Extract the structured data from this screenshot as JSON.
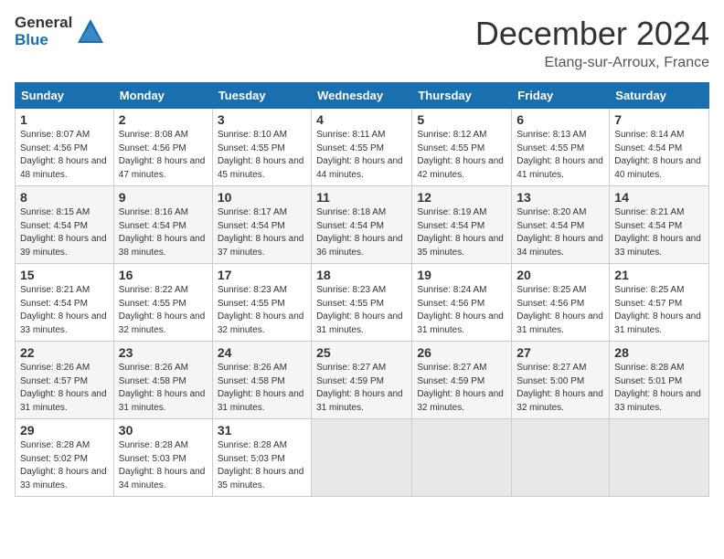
{
  "header": {
    "logo_general": "General",
    "logo_blue": "Blue",
    "month": "December 2024",
    "location": "Etang-sur-Arroux, France"
  },
  "weekdays": [
    "Sunday",
    "Monday",
    "Tuesday",
    "Wednesday",
    "Thursday",
    "Friday",
    "Saturday"
  ],
  "weeks": [
    [
      {
        "day": 1,
        "sunrise": "8:07 AM",
        "sunset": "4:56 PM",
        "daylight": "8 hours and 48 minutes."
      },
      {
        "day": 2,
        "sunrise": "8:08 AM",
        "sunset": "4:56 PM",
        "daylight": "8 hours and 47 minutes."
      },
      {
        "day": 3,
        "sunrise": "8:10 AM",
        "sunset": "4:55 PM",
        "daylight": "8 hours and 45 minutes."
      },
      {
        "day": 4,
        "sunrise": "8:11 AM",
        "sunset": "4:55 PM",
        "daylight": "8 hours and 44 minutes."
      },
      {
        "day": 5,
        "sunrise": "8:12 AM",
        "sunset": "4:55 PM",
        "daylight": "8 hours and 42 minutes."
      },
      {
        "day": 6,
        "sunrise": "8:13 AM",
        "sunset": "4:55 PM",
        "daylight": "8 hours and 41 minutes."
      },
      {
        "day": 7,
        "sunrise": "8:14 AM",
        "sunset": "4:54 PM",
        "daylight": "8 hours and 40 minutes."
      }
    ],
    [
      {
        "day": 8,
        "sunrise": "8:15 AM",
        "sunset": "4:54 PM",
        "daylight": "8 hours and 39 minutes."
      },
      {
        "day": 9,
        "sunrise": "8:16 AM",
        "sunset": "4:54 PM",
        "daylight": "8 hours and 38 minutes."
      },
      {
        "day": 10,
        "sunrise": "8:17 AM",
        "sunset": "4:54 PM",
        "daylight": "8 hours and 37 minutes."
      },
      {
        "day": 11,
        "sunrise": "8:18 AM",
        "sunset": "4:54 PM",
        "daylight": "8 hours and 36 minutes."
      },
      {
        "day": 12,
        "sunrise": "8:19 AM",
        "sunset": "4:54 PM",
        "daylight": "8 hours and 35 minutes."
      },
      {
        "day": 13,
        "sunrise": "8:20 AM",
        "sunset": "4:54 PM",
        "daylight": "8 hours and 34 minutes."
      },
      {
        "day": 14,
        "sunrise": "8:21 AM",
        "sunset": "4:54 PM",
        "daylight": "8 hours and 33 minutes."
      }
    ],
    [
      {
        "day": 15,
        "sunrise": "8:21 AM",
        "sunset": "4:54 PM",
        "daylight": "8 hours and 33 minutes."
      },
      {
        "day": 16,
        "sunrise": "8:22 AM",
        "sunset": "4:55 PM",
        "daylight": "8 hours and 32 minutes."
      },
      {
        "day": 17,
        "sunrise": "8:23 AM",
        "sunset": "4:55 PM",
        "daylight": "8 hours and 32 minutes."
      },
      {
        "day": 18,
        "sunrise": "8:23 AM",
        "sunset": "4:55 PM",
        "daylight": "8 hours and 31 minutes."
      },
      {
        "day": 19,
        "sunrise": "8:24 AM",
        "sunset": "4:56 PM",
        "daylight": "8 hours and 31 minutes."
      },
      {
        "day": 20,
        "sunrise": "8:25 AM",
        "sunset": "4:56 PM",
        "daylight": "8 hours and 31 minutes."
      },
      {
        "day": 21,
        "sunrise": "8:25 AM",
        "sunset": "4:57 PM",
        "daylight": "8 hours and 31 minutes."
      }
    ],
    [
      {
        "day": 22,
        "sunrise": "8:26 AM",
        "sunset": "4:57 PM",
        "daylight": "8 hours and 31 minutes."
      },
      {
        "day": 23,
        "sunrise": "8:26 AM",
        "sunset": "4:58 PM",
        "daylight": "8 hours and 31 minutes."
      },
      {
        "day": 24,
        "sunrise": "8:26 AM",
        "sunset": "4:58 PM",
        "daylight": "8 hours and 31 minutes."
      },
      {
        "day": 25,
        "sunrise": "8:27 AM",
        "sunset": "4:59 PM",
        "daylight": "8 hours and 31 minutes."
      },
      {
        "day": 26,
        "sunrise": "8:27 AM",
        "sunset": "4:59 PM",
        "daylight": "8 hours and 32 minutes."
      },
      {
        "day": 27,
        "sunrise": "8:27 AM",
        "sunset": "5:00 PM",
        "daylight": "8 hours and 32 minutes."
      },
      {
        "day": 28,
        "sunrise": "8:28 AM",
        "sunset": "5:01 PM",
        "daylight": "8 hours and 33 minutes."
      }
    ],
    [
      {
        "day": 29,
        "sunrise": "8:28 AM",
        "sunset": "5:02 PM",
        "daylight": "8 hours and 33 minutes."
      },
      {
        "day": 30,
        "sunrise": "8:28 AM",
        "sunset": "5:03 PM",
        "daylight": "8 hours and 34 minutes."
      },
      {
        "day": 31,
        "sunrise": "8:28 AM",
        "sunset": "5:03 PM",
        "daylight": "8 hours and 35 minutes."
      },
      null,
      null,
      null,
      null
    ]
  ]
}
